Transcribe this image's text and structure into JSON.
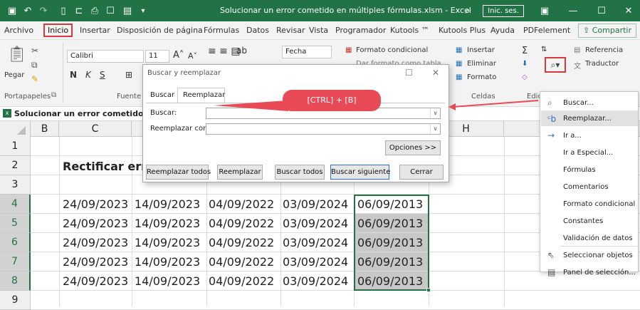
{
  "titlebar": {
    "title": "Solucionar un error cometido en múltiples fórmulas.xlsm  -  Excel",
    "login": "Inic. ses.",
    "icons": [
      "save-icon",
      "undo-icon",
      "redo-icon",
      "new-icon",
      "open-icon",
      "print-icon",
      "form-icon",
      "quick-access-icon"
    ]
  },
  "menu": {
    "items": [
      "Archivo",
      "Inicio",
      "Insertar",
      "Disposición de página",
      "Fórmulas",
      "Datos",
      "Revisar",
      "Vista",
      "Programador",
      "Kutools ™",
      "Kutools Plus",
      "Ayuda",
      "PDFelement"
    ],
    "share": "Compartir"
  },
  "ribbon": {
    "paste": "Pegar",
    "clipboard": "Portapapeles",
    "font_name": "Calibri",
    "font_size": "11",
    "bold": "N",
    "italic": "K",
    "underline": "S",
    "font_group": "Fuente",
    "number_format": "Fecha",
    "cond_format": "Formato condicional",
    "table_format": "Dar formato como tabla",
    "insert": "Insertar",
    "delete": "Eliminar",
    "format": "Formato",
    "cells_group": "Celdas",
    "edit_group": "Edic",
    "reference": "Referencia",
    "translator": "Traductor"
  },
  "formula_bar": {
    "doc_label": "Solucionar un error cometido en"
  },
  "sheet": {
    "columns": [
      "B",
      "C",
      "H"
    ],
    "rows": [
      "1",
      "2",
      "3",
      "4",
      "5",
      "6",
      "7",
      "8",
      "9"
    ],
    "heading": "Rectificar erro",
    "date_rows": [
      [
        "24/09/2023",
        "14/09/2023",
        "04/09/2022",
        "03/09/2024",
        "06/09/2013"
      ],
      [
        "24/09/2023",
        "14/09/2023",
        "04/09/2022",
        "03/09/2024",
        "06/09/2013"
      ],
      [
        "24/09/2023",
        "14/09/2023",
        "04/09/2022",
        "03/09/2024",
        "06/09/2013"
      ],
      [
        "24/09/2023",
        "14/09/2023",
        "04/09/2022",
        "03/09/2024",
        "06/09/2013"
      ],
      [
        "24/09/2023",
        "14/09/2023",
        "04/09/2022",
        "03/09/2024",
        "06/09/2013"
      ]
    ]
  },
  "dialog": {
    "title": "Buscar y reemplazar",
    "tab_find": "Buscar",
    "tab_replace": "Reemplazar",
    "find_label": "Buscar:",
    "replace_label": "Reemplazar con:",
    "find_value": "",
    "replace_value": "",
    "options": "Opciones >>",
    "replace_all": "Reemplazar todos",
    "replace": "Reemplazar",
    "find_all": "Buscar todos",
    "find_next": "Buscar siguiente",
    "close": "Cerrar"
  },
  "callout": "[CTRL] + [B]",
  "dropdown": {
    "items": [
      "Buscar...",
      "Reemplazar...",
      "Ir a...",
      "Ir a Especial...",
      "Fórmulas",
      "Comentarios",
      "Formato condicional",
      "Constantes",
      "Validación de datos",
      "Seleccionar objetos",
      "Panel de selección..."
    ]
  },
  "colors": {
    "excel_green": "#217346",
    "callout_red": "#e84b55",
    "highlight": "#c8c8c8"
  }
}
